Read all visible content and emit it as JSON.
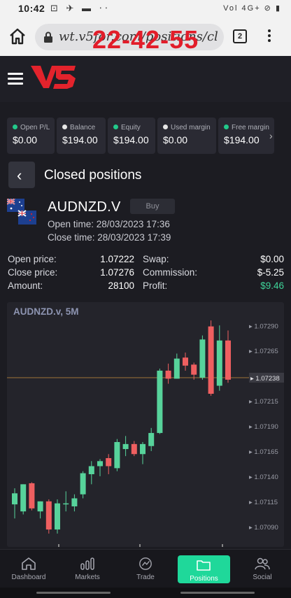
{
  "status_bar": {
    "time": "10:42",
    "icons": "⊡ ✈ ▬ ⋅⋅",
    "right": "Vol 4G+ ⊘ ▮"
  },
  "browser": {
    "url": "wt.v5for.com/positions/cl",
    "tab_count": "2",
    "overlay_timestamp": "22-42-55"
  },
  "header": {
    "logo_text": "V5"
  },
  "stats": [
    {
      "label": "Open P/L",
      "value": "$0.00",
      "dot": "#22c98a"
    },
    {
      "label": "Balance",
      "value": "$194.00",
      "dot": "#e6e6e6"
    },
    {
      "label": "Equity",
      "value": "$194.00",
      "dot": "#22c98a"
    },
    {
      "label": "Used margin",
      "value": "$0.00",
      "dot": "#e6e6e6"
    },
    {
      "label": "Free margin",
      "value": "$194.00",
      "dot": "#22c98a"
    }
  ],
  "page": {
    "title": "Closed positions"
  },
  "position": {
    "symbol": "AUDNZD.V",
    "side": "Buy",
    "open_time": "Open time: 28/03/2023 17:36",
    "close_time": "Close time: 28/03/2023 17:39",
    "details_left": [
      {
        "label": "Open price:",
        "value": "1.07222"
      },
      {
        "label": "Close price:",
        "value": "1.07276"
      },
      {
        "label": "Amount:",
        "value": "28100"
      }
    ],
    "details_right": [
      {
        "label": "Swap:",
        "value": "$0.00",
        "color": "#ffffff"
      },
      {
        "label": "Commission:",
        "value": "$-5.25",
        "color": "#ffffff"
      },
      {
        "label": "Profit:",
        "value": "$9.46",
        "color": "#3fd59a"
      }
    ]
  },
  "chart_data": {
    "type": "candlestick",
    "title": "AUDNZD.v, 5M",
    "y_ticks": [
      "1.07290",
      "1.07265",
      "1.07238",
      "1.07215",
      "1.07190",
      "1.07165",
      "1.07140",
      "1.07115",
      "1.07090"
    ],
    "ylim": [
      1.07078,
      1.07302
    ],
    "current_price": 1.07238,
    "current_price_label": "1.07238",
    "up_color": "#57d39b",
    "down_color": "#ef5f60",
    "candles": [
      {
        "o": 1.07112,
        "h": 1.07128,
        "l": 1.07098,
        "c": 1.07123
      },
      {
        "o": 1.07105,
        "h": 1.07132,
        "l": 1.07102,
        "c": 1.07132
      },
      {
        "o": 1.07133,
        "h": 1.07134,
        "l": 1.07106,
        "c": 1.07108
      },
      {
        "o": 1.07105,
        "h": 1.07115,
        "l": 1.07098,
        "c": 1.07115
      },
      {
        "o": 1.07115,
        "h": 1.07117,
        "l": 1.07083,
        "c": 1.07087
      },
      {
        "o": 1.07087,
        "h": 1.07117,
        "l": 1.07083,
        "c": 1.07113
      },
      {
        "o": 1.07113,
        "h": 1.07125,
        "l": 1.07105,
        "c": 1.07113
      },
      {
        "o": 1.0711,
        "h": 1.07122,
        "l": 1.07105,
        "c": 1.07118
      },
      {
        "o": 1.07122,
        "h": 1.07145,
        "l": 1.07118,
        "c": 1.07143
      },
      {
        "o": 1.07142,
        "h": 1.07155,
        "l": 1.07132,
        "c": 1.0715
      },
      {
        "o": 1.0715,
        "h": 1.07157,
        "l": 1.0714,
        "c": 1.07155
      },
      {
        "o": 1.07158,
        "h": 1.07162,
        "l": 1.07142,
        "c": 1.0715
      },
      {
        "o": 1.07148,
        "h": 1.07177,
        "l": 1.07145,
        "c": 1.07174
      },
      {
        "o": 1.07167,
        "h": 1.0718,
        "l": 1.0716,
        "c": 1.07172
      },
      {
        "o": 1.07172,
        "h": 1.07175,
        "l": 1.0716,
        "c": 1.07162
      },
      {
        "o": 1.07162,
        "h": 1.07174,
        "l": 1.07152,
        "c": 1.07172
      },
      {
        "o": 1.0717,
        "h": 1.07188,
        "l": 1.07165,
        "c": 1.07183
      },
      {
        "o": 1.07183,
        "h": 1.07247,
        "l": 1.07182,
        "c": 1.07245
      },
      {
        "o": 1.07245,
        "h": 1.07252,
        "l": 1.07232,
        "c": 1.07237
      },
      {
        "o": 1.07237,
        "h": 1.07262,
        "l": 1.07237,
        "c": 1.07257
      },
      {
        "o": 1.07258,
        "h": 1.07263,
        "l": 1.07245,
        "c": 1.0725
      },
      {
        "o": 1.07251,
        "h": 1.07253,
        "l": 1.07236,
        "c": 1.07241
      },
      {
        "o": 1.07238,
        "h": 1.0728,
        "l": 1.07236,
        "c": 1.07276
      },
      {
        "o": 1.07289,
        "h": 1.07295,
        "l": 1.0722,
        "c": 1.07222
      },
      {
        "o": 1.0723,
        "h": 1.0729,
        "l": 1.07225,
        "c": 1.07275
      },
      {
        "o": 1.07275,
        "h": 1.07285,
        "l": 1.07233,
        "c": 1.07236
      }
    ]
  },
  "bottom_nav": [
    {
      "label": "Dashboard"
    },
    {
      "label": "Markets"
    },
    {
      "label": "Trade"
    },
    {
      "label": "Positions"
    },
    {
      "label": "Social"
    }
  ]
}
